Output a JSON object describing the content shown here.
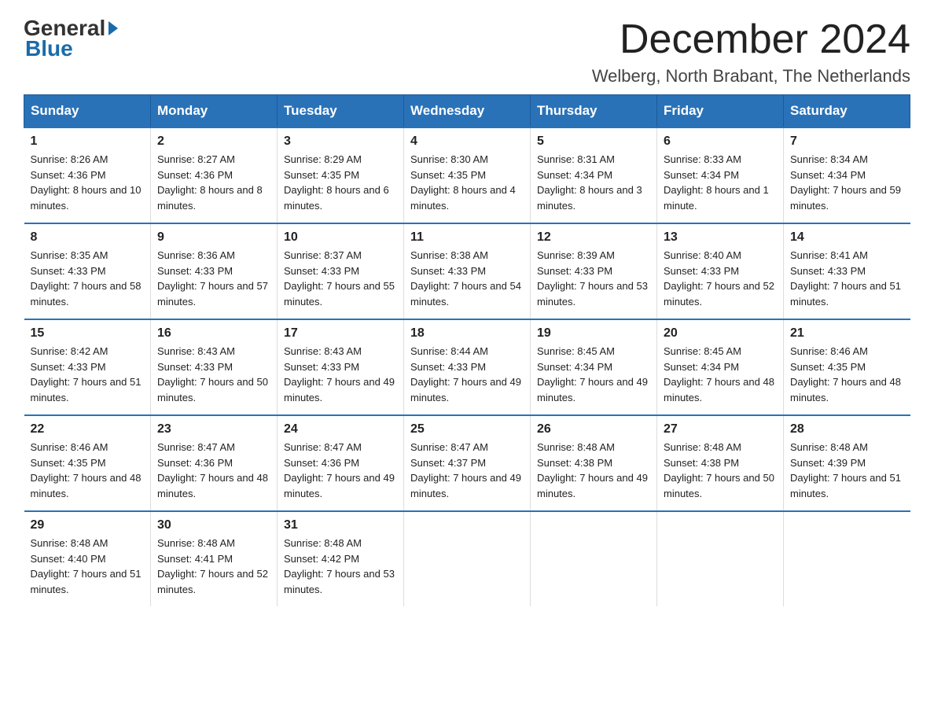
{
  "logo": {
    "general": "General",
    "blue": "Blue",
    "arrow": true
  },
  "title": "December 2024",
  "location": "Welberg, North Brabant, The Netherlands",
  "days_of_week": [
    "Sunday",
    "Monday",
    "Tuesday",
    "Wednesday",
    "Thursday",
    "Friday",
    "Saturday"
  ],
  "weeks": [
    [
      {
        "day": "1",
        "sunrise": "8:26 AM",
        "sunset": "4:36 PM",
        "daylight": "8 hours and 10 minutes."
      },
      {
        "day": "2",
        "sunrise": "8:27 AM",
        "sunset": "4:36 PM",
        "daylight": "8 hours and 8 minutes."
      },
      {
        "day": "3",
        "sunrise": "8:29 AM",
        "sunset": "4:35 PM",
        "daylight": "8 hours and 6 minutes."
      },
      {
        "day": "4",
        "sunrise": "8:30 AM",
        "sunset": "4:35 PM",
        "daylight": "8 hours and 4 minutes."
      },
      {
        "day": "5",
        "sunrise": "8:31 AM",
        "sunset": "4:34 PM",
        "daylight": "8 hours and 3 minutes."
      },
      {
        "day": "6",
        "sunrise": "8:33 AM",
        "sunset": "4:34 PM",
        "daylight": "8 hours and 1 minute."
      },
      {
        "day": "7",
        "sunrise": "8:34 AM",
        "sunset": "4:34 PM",
        "daylight": "7 hours and 59 minutes."
      }
    ],
    [
      {
        "day": "8",
        "sunrise": "8:35 AM",
        "sunset": "4:33 PM",
        "daylight": "7 hours and 58 minutes."
      },
      {
        "day": "9",
        "sunrise": "8:36 AM",
        "sunset": "4:33 PM",
        "daylight": "7 hours and 57 minutes."
      },
      {
        "day": "10",
        "sunrise": "8:37 AM",
        "sunset": "4:33 PM",
        "daylight": "7 hours and 55 minutes."
      },
      {
        "day": "11",
        "sunrise": "8:38 AM",
        "sunset": "4:33 PM",
        "daylight": "7 hours and 54 minutes."
      },
      {
        "day": "12",
        "sunrise": "8:39 AM",
        "sunset": "4:33 PM",
        "daylight": "7 hours and 53 minutes."
      },
      {
        "day": "13",
        "sunrise": "8:40 AM",
        "sunset": "4:33 PM",
        "daylight": "7 hours and 52 minutes."
      },
      {
        "day": "14",
        "sunrise": "8:41 AM",
        "sunset": "4:33 PM",
        "daylight": "7 hours and 51 minutes."
      }
    ],
    [
      {
        "day": "15",
        "sunrise": "8:42 AM",
        "sunset": "4:33 PM",
        "daylight": "7 hours and 51 minutes."
      },
      {
        "day": "16",
        "sunrise": "8:43 AM",
        "sunset": "4:33 PM",
        "daylight": "7 hours and 50 minutes."
      },
      {
        "day": "17",
        "sunrise": "8:43 AM",
        "sunset": "4:33 PM",
        "daylight": "7 hours and 49 minutes."
      },
      {
        "day": "18",
        "sunrise": "8:44 AM",
        "sunset": "4:33 PM",
        "daylight": "7 hours and 49 minutes."
      },
      {
        "day": "19",
        "sunrise": "8:45 AM",
        "sunset": "4:34 PM",
        "daylight": "7 hours and 49 minutes."
      },
      {
        "day": "20",
        "sunrise": "8:45 AM",
        "sunset": "4:34 PM",
        "daylight": "7 hours and 48 minutes."
      },
      {
        "day": "21",
        "sunrise": "8:46 AM",
        "sunset": "4:35 PM",
        "daylight": "7 hours and 48 minutes."
      }
    ],
    [
      {
        "day": "22",
        "sunrise": "8:46 AM",
        "sunset": "4:35 PM",
        "daylight": "7 hours and 48 minutes."
      },
      {
        "day": "23",
        "sunrise": "8:47 AM",
        "sunset": "4:36 PM",
        "daylight": "7 hours and 48 minutes."
      },
      {
        "day": "24",
        "sunrise": "8:47 AM",
        "sunset": "4:36 PM",
        "daylight": "7 hours and 49 minutes."
      },
      {
        "day": "25",
        "sunrise": "8:47 AM",
        "sunset": "4:37 PM",
        "daylight": "7 hours and 49 minutes."
      },
      {
        "day": "26",
        "sunrise": "8:48 AM",
        "sunset": "4:38 PM",
        "daylight": "7 hours and 49 minutes."
      },
      {
        "day": "27",
        "sunrise": "8:48 AM",
        "sunset": "4:38 PM",
        "daylight": "7 hours and 50 minutes."
      },
      {
        "day": "28",
        "sunrise": "8:48 AM",
        "sunset": "4:39 PM",
        "daylight": "7 hours and 51 minutes."
      }
    ],
    [
      {
        "day": "29",
        "sunrise": "8:48 AM",
        "sunset": "4:40 PM",
        "daylight": "7 hours and 51 minutes."
      },
      {
        "day": "30",
        "sunrise": "8:48 AM",
        "sunset": "4:41 PM",
        "daylight": "7 hours and 52 minutes."
      },
      {
        "day": "31",
        "sunrise": "8:48 AM",
        "sunset": "4:42 PM",
        "daylight": "7 hours and 53 minutes."
      },
      null,
      null,
      null,
      null
    ]
  ]
}
